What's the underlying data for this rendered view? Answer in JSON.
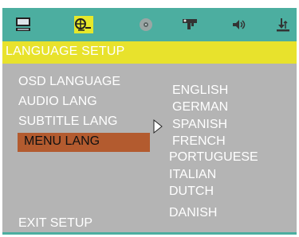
{
  "toolbar": {
    "icons": [
      "monitor-icon",
      "language-icon",
      "disc-icon",
      "video-icon",
      "speaker-icon",
      "download-icon"
    ],
    "active_icon": "language-icon"
  },
  "header": {
    "title": "LANGUAGE SETUP"
  },
  "menu": {
    "items": [
      "OSD LANGUAGE",
      "AUDIO LANG",
      "SUBTITLE LANG",
      "MENU LANG"
    ],
    "selected": "MENU LANG",
    "exit": "EXIT SETUP"
  },
  "options": [
    "ENGLISH",
    "GERMAN",
    "SPANISH",
    "FRENCH",
    "PORTUGUESE",
    "ITALIAN",
    "DUTCH",
    "DANISH"
  ],
  "colors": {
    "teal": "#4caea0",
    "yellow": "#e8e22c",
    "body_gray": "#b4b4b4",
    "selection": "#b35b2f"
  }
}
